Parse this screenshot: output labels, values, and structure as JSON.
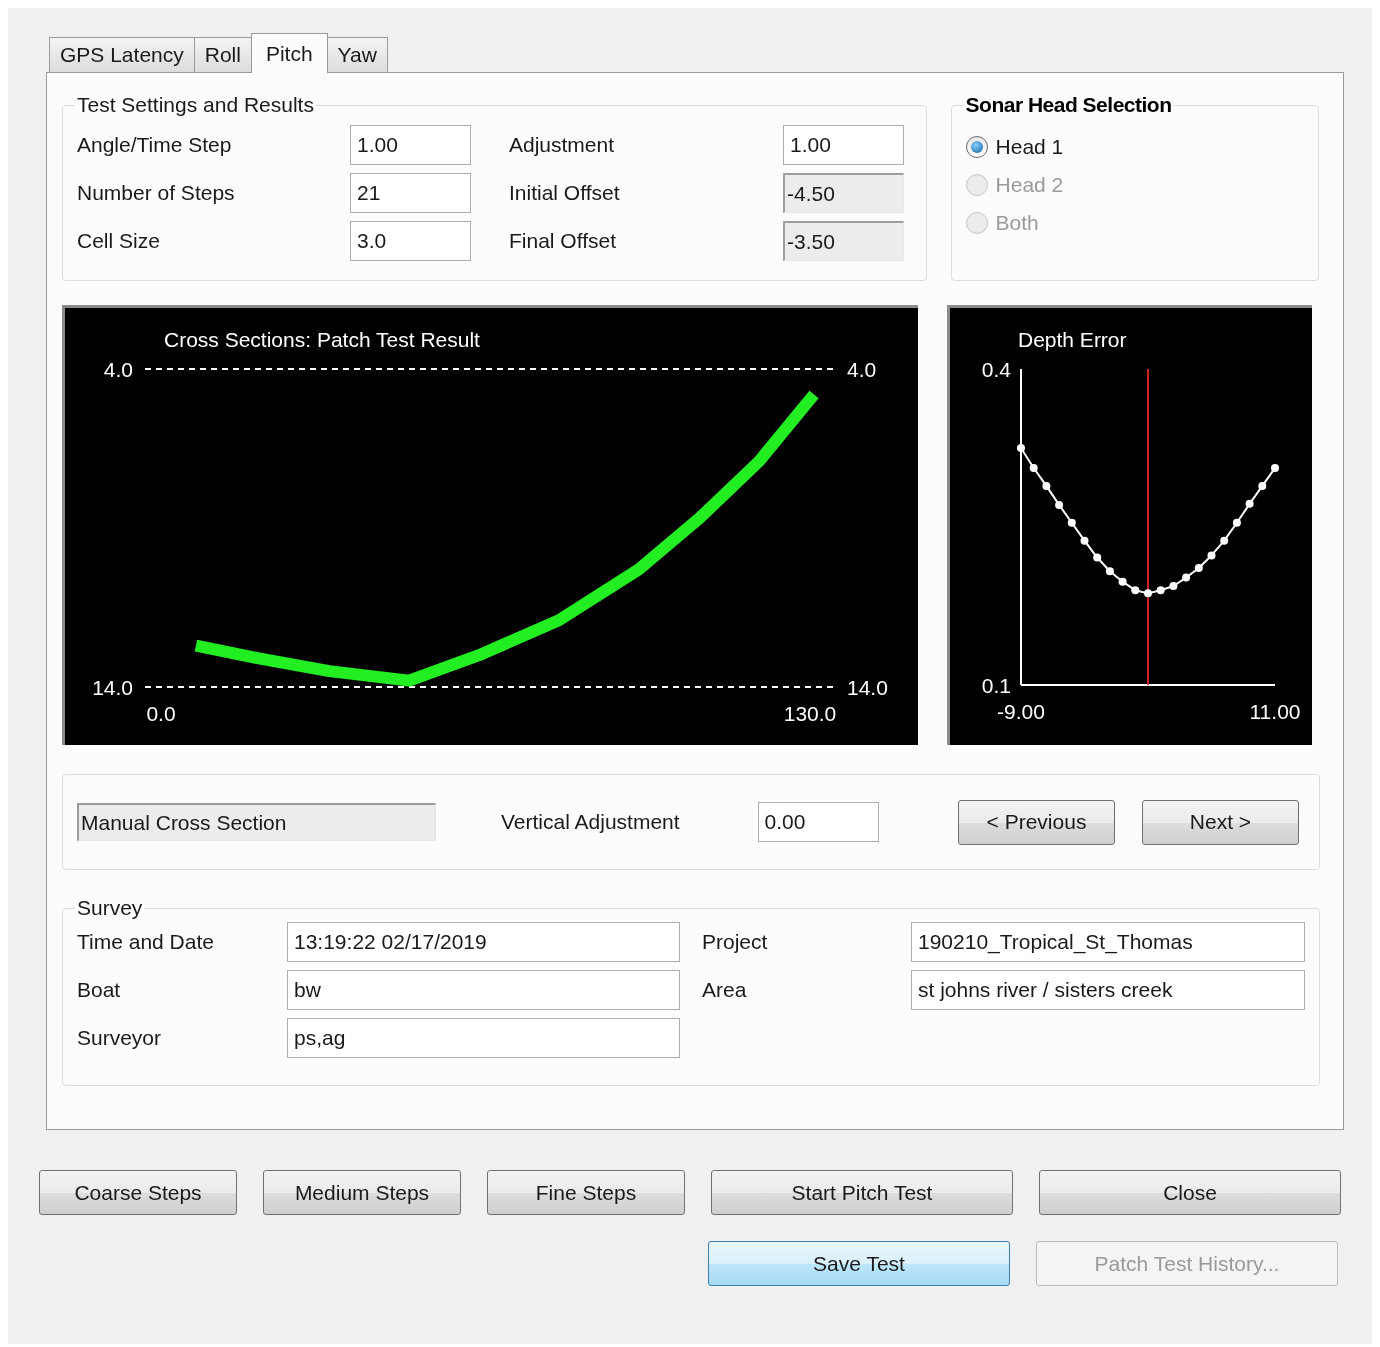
{
  "tabs": [
    {
      "label": "GPS Latency",
      "selected": false
    },
    {
      "label": "Roll",
      "selected": false
    },
    {
      "label": "Pitch",
      "selected": true
    },
    {
      "label": "Yaw",
      "selected": false
    }
  ],
  "test_settings": {
    "title": "Test Settings and Results",
    "fields": [
      {
        "label": "Angle/Time Step",
        "value": "1.00",
        "disabled": false
      },
      {
        "label": "Adjustment",
        "value": "1.00",
        "disabled": false
      },
      {
        "label": "Number of Steps",
        "value": "21",
        "disabled": false
      },
      {
        "label": "Initial Offset",
        "value": "-4.50",
        "disabled": true
      },
      {
        "label": "Cell Size",
        "value": "3.0",
        "disabled": false
      },
      {
        "label": "Final Offset",
        "value": "-3.50",
        "disabled": true
      }
    ]
  },
  "sonar_head_selection": {
    "title": "Sonar Head Selection",
    "options": [
      {
        "label": "Head 1",
        "selected": true,
        "disabled": false
      },
      {
        "label": "Head 2",
        "selected": false,
        "disabled": true
      },
      {
        "label": "Both",
        "selected": false,
        "disabled": true
      }
    ]
  },
  "cross_section_chart": {
    "chart_data": {
      "type": "line",
      "title": "Cross Sections: Patch Test Result",
      "x": [
        7.0,
        19.6,
        33.7,
        49.7,
        63.7,
        79.7,
        95.7,
        107.8,
        119.8,
        130.8
      ],
      "series": [
        {
          "color": "#22ee22",
          "values": [
            12.7,
            13.1,
            13.5,
            13.8,
            13.0,
            11.9,
            10.3,
            8.7,
            6.9,
            4.8
          ]
        }
      ],
      "xlim": [
        -3.2,
        135.4
      ],
      "ylim": [
        14,
        4
      ],
      "xticks": [
        {
          "value": 0,
          "label": "0.0"
        },
        {
          "value": 130,
          "label": "130.0"
        }
      ],
      "yticks": [
        {
          "value": 4,
          "label": "4.0"
        },
        {
          "value": 14,
          "label": "14.0"
        }
      ],
      "y2lim": [
        14,
        4
      ],
      "y2ticks": [
        {
          "value": 4,
          "label": "4.0"
        },
        {
          "value": 14,
          "label": "14.0"
        }
      ]
    }
  },
  "depth_error_chart": {
    "chart_data": {
      "type": "line",
      "title": "Depth Error",
      "x": [
        -9,
        -8,
        -7,
        -6,
        -5,
        -4,
        -3,
        -2,
        -1,
        0,
        1,
        2,
        3,
        4,
        5,
        6,
        7,
        8,
        9,
        10,
        11
      ],
      "series": [
        {
          "color": "#ffffff",
          "marker": "o",
          "values": [
            0.325,
            0.306,
            0.289,
            0.271,
            0.254,
            0.237,
            0.221,
            0.208,
            0.198,
            0.19,
            0.187,
            0.19,
            0.194,
            0.202,
            0.211,
            0.223,
            0.237,
            0.254,
            0.272,
            0.289,
            0.306
          ]
        }
      ],
      "xlim": [
        -9,
        11
      ],
      "ylim": [
        0.1,
        0.4
      ],
      "xticks": [
        {
          "value": -9,
          "label": "-9.00"
        },
        {
          "value": 11,
          "label": "11.00"
        }
      ],
      "yticks": [
        {
          "value": 0.1,
          "label": "0.1"
        },
        {
          "value": 0.4,
          "label": "0.4"
        }
      ],
      "ref_lines": [
        {
          "axis": "x",
          "value": 1,
          "color": "#cc2222"
        }
      ]
    }
  },
  "manual": {
    "field": {
      "value": "Manual Cross Section",
      "disabled": true
    },
    "vertical_adjustment": {
      "label": "Vertical Adjustment",
      "value": "0.00"
    },
    "buttons": [
      {
        "label": "< Previous"
      },
      {
        "label": "Next >"
      }
    ]
  },
  "survey": {
    "title": "Survey",
    "fields": [
      {
        "label": "Time and Date",
        "value": "13:19:22 02/17/2019"
      },
      {
        "label": "Project",
        "value": "190210_Tropical_St_Thomas"
      },
      {
        "label": "Boat",
        "value": "bw"
      },
      {
        "label": "Area",
        "value": "st johns river / sisters creek"
      },
      {
        "label": "Surveyor",
        "value": "ps,ag"
      }
    ]
  },
  "buttons": [
    {
      "label": "Coarse Steps",
      "kind": "normal",
      "disabled": false
    },
    {
      "label": "Medium Steps",
      "kind": "normal",
      "disabled": false
    },
    {
      "label": "Fine Steps",
      "kind": "normal",
      "disabled": false
    },
    {
      "label": "Start Pitch Test",
      "kind": "wide",
      "disabled": false
    },
    {
      "label": "Close",
      "kind": "wide",
      "disabled": false
    },
    {
      "label": "Save Test",
      "kind": "default",
      "disabled": false
    },
    {
      "label": "Patch Test History...",
      "kind": "wide",
      "disabled": true
    }
  ]
}
